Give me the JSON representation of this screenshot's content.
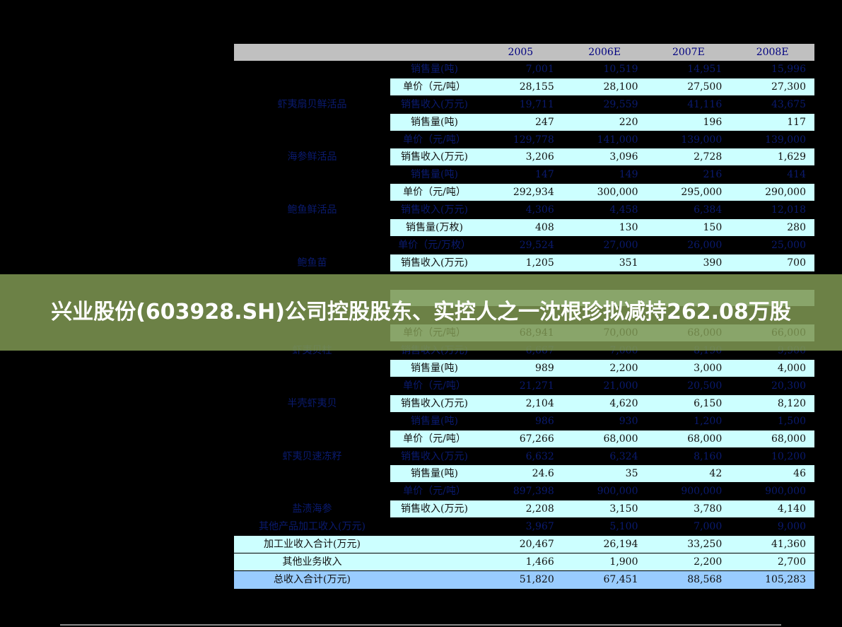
{
  "banner": {
    "title": "兴业股份(603928.SH)公司控股股东、实控人之一沈根珍拟减持262.08万股"
  },
  "header": {
    "cols": [
      "2005",
      "2006E",
      "2007E",
      "2008E"
    ]
  },
  "rows": [
    {
      "group": "",
      "item": "销售量(吨)",
      "values": [
        "7,001",
        "10,519",
        "14,951",
        "15,996"
      ],
      "hl": false
    },
    {
      "group": "",
      "item": "单价（元/吨）",
      "values": [
        "28,155",
        "28,100",
        "27,500",
        "27,300"
      ],
      "hl": true
    },
    {
      "group": "虾夷扇贝鲜活品",
      "item": "销售收入(万元)",
      "values": [
        "19,711",
        "29,559",
        "41,116",
        "43,675"
      ],
      "hl": false
    },
    {
      "group": "",
      "item": "销售量(吨)",
      "values": [
        "247",
        "220",
        "196",
        "117"
      ],
      "hl": true
    },
    {
      "group": "",
      "item": "单价（元/吨）",
      "values": [
        "129,778",
        "141,000",
        "139,000",
        "139,000"
      ],
      "hl": false
    },
    {
      "group": "海参鲜活品",
      "item": "销售收入(万元)",
      "values": [
        "3,206",
        "3,096",
        "2,728",
        "1,629"
      ],
      "hl": true
    },
    {
      "group": "",
      "item": "销售量(吨)",
      "values": [
        "147",
        "149",
        "216",
        "414"
      ],
      "hl": false
    },
    {
      "group": "",
      "item": "单价（元/吨）",
      "values": [
        "292,934",
        "300,000",
        "295,000",
        "290,000"
      ],
      "hl": true
    },
    {
      "group": "鲍鱼鲜活品",
      "item": "销售收入(万元)",
      "values": [
        "4,306",
        "4,458",
        "6,384",
        "12,018"
      ],
      "hl": false
    },
    {
      "group": "",
      "item": "销售量(万枚)",
      "values": [
        "408",
        "130",
        "150",
        "280"
      ],
      "hl": true
    },
    {
      "group": "",
      "item": "单价（元/万枚）",
      "values": [
        "29,524",
        "27,000",
        "26,000",
        "25,000"
      ],
      "hl": false
    },
    {
      "group": "鲍鱼苗",
      "item": "销售收入(万元)",
      "values": [
        "1,205",
        "351",
        "390",
        "700"
      ],
      "hl": true
    },
    {
      "group": "",
      "item": "",
      "values": [
        "",
        "",
        "",
        ""
      ],
      "hl": false
    },
    {
      "group": "",
      "item": "",
      "values": [
        "",
        "",
        "",
        ""
      ],
      "hl": true
    },
    {
      "group": "",
      "item": "",
      "values": [
        "",
        "",
        "",
        ""
      ],
      "hl": false
    },
    {
      "group": "",
      "item": "单价（元/吨）",
      "values": [
        "68,941",
        "70,000",
        "68,000",
        "66,000"
      ],
      "hl": true
    },
    {
      "group": "虾夷贝柱",
      "item": "销售收入(万元)",
      "values": [
        "6,667",
        "7,000",
        "8,190",
        "9,900"
      ],
      "hl": false
    },
    {
      "group": "",
      "item": "销售量(吨)",
      "values": [
        "989",
        "2,200",
        "3,000",
        "4,000"
      ],
      "hl": true
    },
    {
      "group": "",
      "item": "单价（元/吨）",
      "values": [
        "21,271",
        "21,000",
        "20,500",
        "20,300"
      ],
      "hl": false
    },
    {
      "group": "半壳虾夷贝",
      "item": "销售收入(万元)",
      "values": [
        "2,104",
        "4,620",
        "6,150",
        "8,120"
      ],
      "hl": true
    },
    {
      "group": "",
      "item": "销售量(吨)",
      "values": [
        "986",
        "930",
        "1,200",
        "1,500"
      ],
      "hl": false
    },
    {
      "group": "",
      "item": "单价（元/吨）",
      "values": [
        "67,266",
        "68,000",
        "68,000",
        "68,000"
      ],
      "hl": true
    },
    {
      "group": "虾夷贝速冻籽",
      "item": "销售收入(万元)",
      "values": [
        "6,632",
        "6,324",
        "8,160",
        "10,200"
      ],
      "hl": false
    },
    {
      "group": "",
      "item": "销售量(吨)",
      "values": [
        "24.6",
        "35",
        "42",
        "46"
      ],
      "hl": true
    },
    {
      "group": "",
      "item": "单价（元/吨）",
      "values": [
        "897,398",
        "900,000",
        "900,000",
        "900,000"
      ],
      "hl": false
    },
    {
      "group": "盐渍海参",
      "item": "销售收入(万元)",
      "values": [
        "2,208",
        "3,150",
        "3,780",
        "4,140"
      ],
      "hl": true
    },
    {
      "group": "其他产品加工收入(万元)",
      "item": "",
      "values": [
        "3,967",
        "5,100",
        "7,000",
        "9,000"
      ],
      "hl": false
    },
    {
      "group": "加工业收入合计(万元)",
      "item": "",
      "values": [
        "20,467",
        "26,194",
        "33,250",
        "41,360"
      ],
      "hl": true,
      "full": true
    },
    {
      "group": "其他业务收入",
      "item": "",
      "values": [
        "1,466",
        "1,900",
        "2,200",
        "2,700"
      ],
      "hl": true,
      "full": true
    },
    {
      "group": "总收入合计(万元)",
      "item": "",
      "values": [
        "51,820",
        "67,451",
        "88,568",
        "105,283"
      ],
      "total": true
    }
  ]
}
